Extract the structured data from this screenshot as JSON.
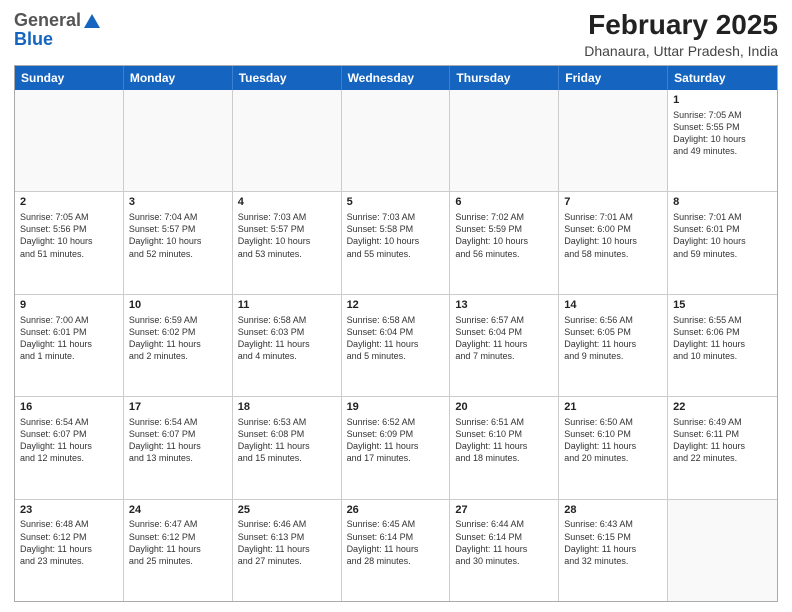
{
  "header": {
    "logo_general": "General",
    "logo_blue": "Blue",
    "month_title": "February 2025",
    "location": "Dhanaura, Uttar Pradesh, India"
  },
  "weekdays": [
    "Sunday",
    "Monday",
    "Tuesday",
    "Wednesday",
    "Thursday",
    "Friday",
    "Saturday"
  ],
  "rows": [
    [
      {
        "day": "",
        "empty": true
      },
      {
        "day": "",
        "empty": true
      },
      {
        "day": "",
        "empty": true
      },
      {
        "day": "",
        "empty": true
      },
      {
        "day": "",
        "empty": true
      },
      {
        "day": "",
        "empty": true
      },
      {
        "day": "1",
        "lines": [
          "Sunrise: 7:05 AM",
          "Sunset: 5:55 PM",
          "Daylight: 10 hours",
          "and 49 minutes."
        ]
      }
    ],
    [
      {
        "day": "2",
        "lines": [
          "Sunrise: 7:05 AM",
          "Sunset: 5:56 PM",
          "Daylight: 10 hours",
          "and 51 minutes."
        ]
      },
      {
        "day": "3",
        "lines": [
          "Sunrise: 7:04 AM",
          "Sunset: 5:57 PM",
          "Daylight: 10 hours",
          "and 52 minutes."
        ]
      },
      {
        "day": "4",
        "lines": [
          "Sunrise: 7:03 AM",
          "Sunset: 5:57 PM",
          "Daylight: 10 hours",
          "and 53 minutes."
        ]
      },
      {
        "day": "5",
        "lines": [
          "Sunrise: 7:03 AM",
          "Sunset: 5:58 PM",
          "Daylight: 10 hours",
          "and 55 minutes."
        ]
      },
      {
        "day": "6",
        "lines": [
          "Sunrise: 7:02 AM",
          "Sunset: 5:59 PM",
          "Daylight: 10 hours",
          "and 56 minutes."
        ]
      },
      {
        "day": "7",
        "lines": [
          "Sunrise: 7:01 AM",
          "Sunset: 6:00 PM",
          "Daylight: 10 hours",
          "and 58 minutes."
        ]
      },
      {
        "day": "8",
        "lines": [
          "Sunrise: 7:01 AM",
          "Sunset: 6:01 PM",
          "Daylight: 10 hours",
          "and 59 minutes."
        ]
      }
    ],
    [
      {
        "day": "9",
        "lines": [
          "Sunrise: 7:00 AM",
          "Sunset: 6:01 PM",
          "Daylight: 11 hours",
          "and 1 minute."
        ]
      },
      {
        "day": "10",
        "lines": [
          "Sunrise: 6:59 AM",
          "Sunset: 6:02 PM",
          "Daylight: 11 hours",
          "and 2 minutes."
        ]
      },
      {
        "day": "11",
        "lines": [
          "Sunrise: 6:58 AM",
          "Sunset: 6:03 PM",
          "Daylight: 11 hours",
          "and 4 minutes."
        ]
      },
      {
        "day": "12",
        "lines": [
          "Sunrise: 6:58 AM",
          "Sunset: 6:04 PM",
          "Daylight: 11 hours",
          "and 5 minutes."
        ]
      },
      {
        "day": "13",
        "lines": [
          "Sunrise: 6:57 AM",
          "Sunset: 6:04 PM",
          "Daylight: 11 hours",
          "and 7 minutes."
        ]
      },
      {
        "day": "14",
        "lines": [
          "Sunrise: 6:56 AM",
          "Sunset: 6:05 PM",
          "Daylight: 11 hours",
          "and 9 minutes."
        ]
      },
      {
        "day": "15",
        "lines": [
          "Sunrise: 6:55 AM",
          "Sunset: 6:06 PM",
          "Daylight: 11 hours",
          "and 10 minutes."
        ]
      }
    ],
    [
      {
        "day": "16",
        "lines": [
          "Sunrise: 6:54 AM",
          "Sunset: 6:07 PM",
          "Daylight: 11 hours",
          "and 12 minutes."
        ]
      },
      {
        "day": "17",
        "lines": [
          "Sunrise: 6:54 AM",
          "Sunset: 6:07 PM",
          "Daylight: 11 hours",
          "and 13 minutes."
        ]
      },
      {
        "day": "18",
        "lines": [
          "Sunrise: 6:53 AM",
          "Sunset: 6:08 PM",
          "Daylight: 11 hours",
          "and 15 minutes."
        ]
      },
      {
        "day": "19",
        "lines": [
          "Sunrise: 6:52 AM",
          "Sunset: 6:09 PM",
          "Daylight: 11 hours",
          "and 17 minutes."
        ]
      },
      {
        "day": "20",
        "lines": [
          "Sunrise: 6:51 AM",
          "Sunset: 6:10 PM",
          "Daylight: 11 hours",
          "and 18 minutes."
        ]
      },
      {
        "day": "21",
        "lines": [
          "Sunrise: 6:50 AM",
          "Sunset: 6:10 PM",
          "Daylight: 11 hours",
          "and 20 minutes."
        ]
      },
      {
        "day": "22",
        "lines": [
          "Sunrise: 6:49 AM",
          "Sunset: 6:11 PM",
          "Daylight: 11 hours",
          "and 22 minutes."
        ]
      }
    ],
    [
      {
        "day": "23",
        "lines": [
          "Sunrise: 6:48 AM",
          "Sunset: 6:12 PM",
          "Daylight: 11 hours",
          "and 23 minutes."
        ]
      },
      {
        "day": "24",
        "lines": [
          "Sunrise: 6:47 AM",
          "Sunset: 6:12 PM",
          "Daylight: 11 hours",
          "and 25 minutes."
        ]
      },
      {
        "day": "25",
        "lines": [
          "Sunrise: 6:46 AM",
          "Sunset: 6:13 PM",
          "Daylight: 11 hours",
          "and 27 minutes."
        ]
      },
      {
        "day": "26",
        "lines": [
          "Sunrise: 6:45 AM",
          "Sunset: 6:14 PM",
          "Daylight: 11 hours",
          "and 28 minutes."
        ]
      },
      {
        "day": "27",
        "lines": [
          "Sunrise: 6:44 AM",
          "Sunset: 6:14 PM",
          "Daylight: 11 hours",
          "and 30 minutes."
        ]
      },
      {
        "day": "28",
        "lines": [
          "Sunrise: 6:43 AM",
          "Sunset: 6:15 PM",
          "Daylight: 11 hours",
          "and 32 minutes."
        ]
      },
      {
        "day": "",
        "empty": true
      }
    ]
  ]
}
